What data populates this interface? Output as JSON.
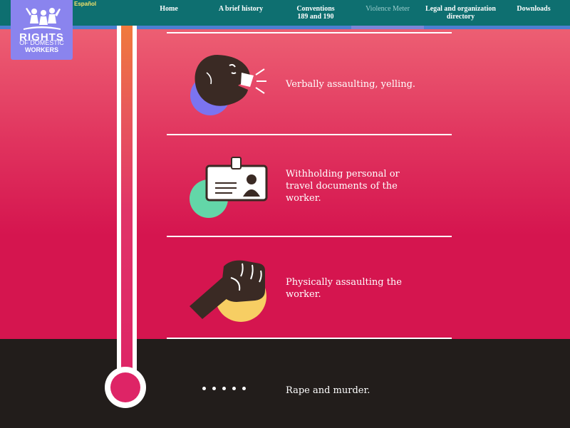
{
  "header": {
    "language_link": "Español",
    "nav": [
      {
        "label_line1": "Home",
        "label_line2": ""
      },
      {
        "label_line1": "A brief history",
        "label_line2": ""
      },
      {
        "label_line1": "Conventions",
        "label_line2": "189 and 190"
      },
      {
        "label_line1": "Violence Meter",
        "label_line2": ""
      },
      {
        "label_line1": "Legal and organization",
        "label_line2": "directory"
      },
      {
        "label_line1": "Downloads",
        "label_line2": ""
      }
    ],
    "active_nav": "Violence Meter"
  },
  "logo": {
    "line1": "RIGHTS",
    "line2": "OF DOMESTIC",
    "line3": "WORKERS"
  },
  "meter": {
    "items": [
      {
        "text_line1": "Verbally assaulting, yelling.",
        "text_line2": "",
        "text_line3": "",
        "icon": "shouting-face-icon",
        "accent": "#7b74f0"
      },
      {
        "text_line1": "Withholding personal or",
        "text_line2": "travel documents of the",
        "text_line3": "worker.",
        "icon": "id-card-icon",
        "accent": "#63d6a8"
      },
      {
        "text_line1": "Physically assaulting the",
        "text_line2": "worker.",
        "text_line3": "",
        "icon": "fist-icon",
        "accent": "#f7ce63"
      },
      {
        "text_line1": "Rape and murder.",
        "text_line2": "",
        "text_line3": "",
        "icon": "ellipsis-dots-icon",
        "accent": "#ffffff"
      }
    ]
  },
  "colors": {
    "topbar": "#0e6f70",
    "pink": "#d5154f",
    "dark": "#221d1b",
    "logo": "#8a84ee"
  }
}
